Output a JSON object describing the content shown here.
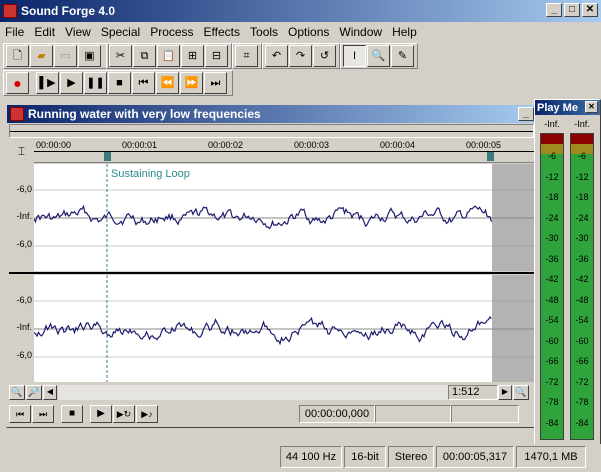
{
  "app": {
    "title": "Sound Forge 4.0"
  },
  "menu": [
    "File",
    "Edit",
    "View",
    "Special",
    "Process",
    "Effects",
    "Tools",
    "Options",
    "Window",
    "Help"
  ],
  "doc": {
    "title": "Running water with very low frequencies",
    "time_labels": [
      "00:00:00",
      "00:00:01",
      "00:00:02",
      "00:00:03",
      "00:00:04",
      "00:00:05"
    ],
    "marker_label": "Sustaining Loop",
    "channel_labels": [
      "-6,0",
      "-Inf.",
      "-6,0"
    ],
    "zoom": "1:512",
    "position": "00:00:00,000"
  },
  "meter": {
    "title": "Play Me",
    "peak_left": "-Inf.",
    "peak_right": "-Inf.",
    "scale": [
      "-6",
      "-12",
      "-18",
      "-24",
      "-30",
      "-36",
      "-42",
      "-48",
      "-54",
      "-60",
      "-66",
      "-72",
      "-78",
      "-84"
    ]
  },
  "status": {
    "rate": "44 100 Hz",
    "bits": "16-bit",
    "channels": "Stereo",
    "length": "00:00:05,317",
    "free": "1470,1 MB"
  },
  "colors": {
    "waveform": "#1c1c6e",
    "titlebar": "#0a246a",
    "meter_green": "#2fa43c",
    "meter_red": "#8b0000"
  }
}
